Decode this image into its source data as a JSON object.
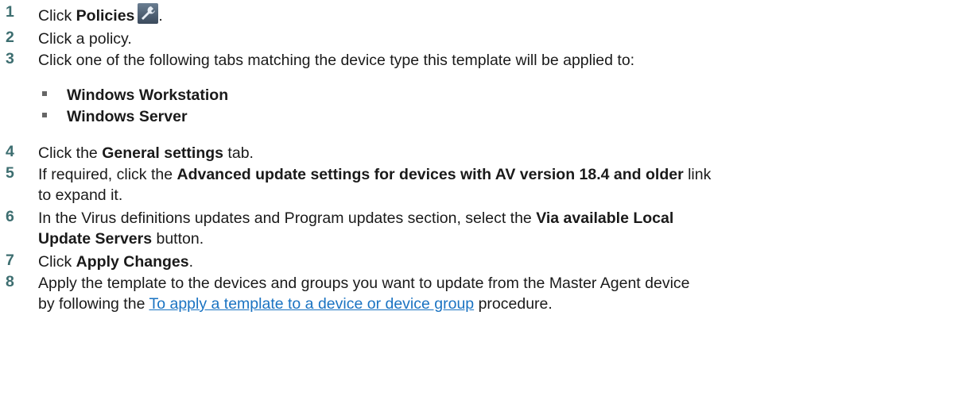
{
  "steps": [
    {
      "num": "1",
      "pre": "Click ",
      "bold": "Policies",
      "post": ".",
      "icon": "wrench-icon"
    },
    {
      "num": "2",
      "text": "Click a policy."
    },
    {
      "num": "3",
      "text": "Click one of the following tabs matching the device type this template will be applied to:"
    },
    {
      "num": "4",
      "pre": "Click the ",
      "bold": "General settings",
      "post": " tab."
    },
    {
      "num": "5",
      "pre": "If required, click the ",
      "bold": "Advanced update settings for devices with AV version 18.4 and older",
      "post": " link",
      "line2": "to expand it."
    },
    {
      "num": "6",
      "pre": "In the Virus definitions updates and Program updates section, select the ",
      "bold": "Via available Local",
      "bold2": "Update Servers",
      "post": " button."
    },
    {
      "num": "7",
      "pre": "Click ",
      "bold": "Apply Changes",
      "post": "."
    },
    {
      "num": "8",
      "text": "Apply the template to the devices and groups you want to update from the Master Agent device",
      "pre2": "by following the ",
      "link": "To apply a template to a device or device group",
      "post2": " procedure."
    }
  ],
  "tabs": [
    "Windows Workstation",
    "Windows Server"
  ],
  "colors": {
    "number": "#3d6e70",
    "link": "#1a73c2",
    "text": "#1a1a1a"
  }
}
